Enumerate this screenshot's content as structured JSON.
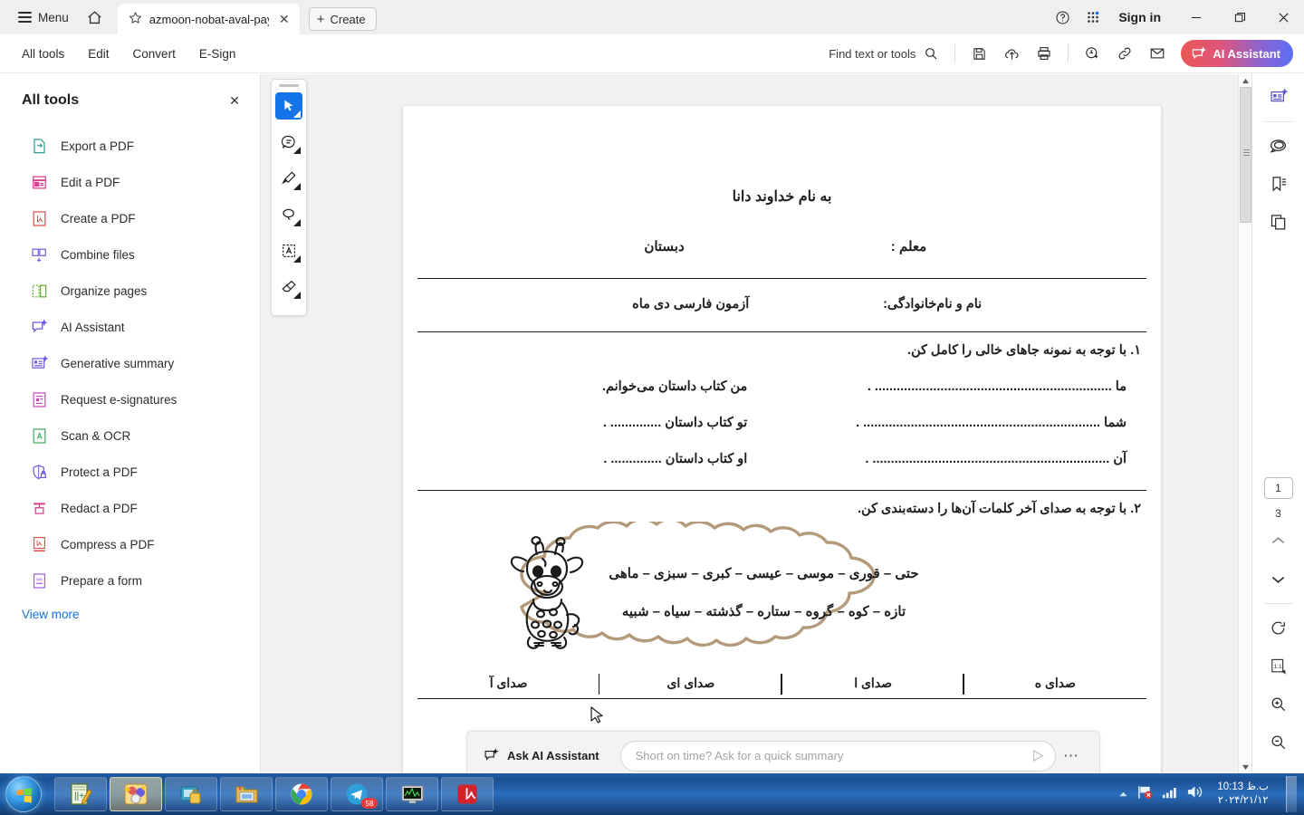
{
  "window": {
    "menu_label": "Menu",
    "signin_label": "Sign in",
    "tab_title": "azmoon-nobat-aval-pay…",
    "create_label": "Create",
    "minimize": "—",
    "maximize": "❐",
    "close": "✕"
  },
  "cmdbar": {
    "tabs": [
      "All tools",
      "Edit",
      "Convert",
      "E-Sign"
    ],
    "find_label": "Find text or tools",
    "ai_label": "AI Assistant",
    "ai_gradient_start": "#eb5757",
    "ai_gradient_end": "#5b6ef5"
  },
  "left_panel": {
    "title": "All tools",
    "close_label": "✕",
    "view_more": "View more",
    "tools": [
      {
        "label": "Export a PDF",
        "icon": "export-pdf-icon",
        "color": "#2e9e8f"
      },
      {
        "label": "Edit a PDF",
        "icon": "edit-pdf-icon",
        "color": "#d6418c"
      },
      {
        "label": "Create a PDF",
        "icon": "create-pdf-icon",
        "color": "#e05252"
      },
      {
        "label": "Combine files",
        "icon": "combine-files-icon",
        "color": "#6a5ae0"
      },
      {
        "label": "Organize pages",
        "icon": "organize-pages-icon",
        "color": "#5fa829"
      },
      {
        "label": "AI Assistant",
        "icon": "ai-assistant-icon",
        "color": "#6a5ae0"
      },
      {
        "label": "Generative summary",
        "icon": "generative-summary-icon",
        "color": "#6a5ae0"
      },
      {
        "label": "Request e-signatures",
        "icon": "request-esignatures-icon",
        "color": "#c945b8"
      },
      {
        "label": "Scan & OCR",
        "icon": "scan-ocr-icon",
        "color": "#3aa85a"
      },
      {
        "label": "Protect a PDF",
        "icon": "protect-pdf-icon",
        "color": "#6a5ae0"
      },
      {
        "label": "Redact a PDF",
        "icon": "redact-pdf-icon",
        "color": "#d6418c"
      },
      {
        "label": "Compress a PDF",
        "icon": "compress-pdf-icon",
        "color": "#e05252"
      },
      {
        "label": "Prepare a form",
        "icon": "prepare-form-icon",
        "color": "#9a5ae0"
      }
    ]
  },
  "vertical_tools": [
    {
      "name": "select-tool",
      "active": true
    },
    {
      "name": "comment-tool",
      "active": false
    },
    {
      "name": "highlight-tool",
      "active": false
    },
    {
      "name": "draw-tool",
      "active": false
    },
    {
      "name": "add-text-tool",
      "active": false
    },
    {
      "name": "erase-tool",
      "active": false
    }
  ],
  "document": {
    "bismillah": "به نام خداوند دانا",
    "school_label": "دبستان",
    "teacher_label": "معلم :",
    "exam_title": "آزمون فارسی دی ماه",
    "name_label": "نام و نام‌خانوادگی:",
    "q1_head": "۱. با توجه به نمونه جاهای خالی را کامل کن.",
    "q1_rows": [
      {
        "right": "من کتاب داستان می‌خوانم.",
        "left": "ما ................................................................. ."
      },
      {
        "right": "تو کتاب داستان .............. .",
        "left": "شما ................................................................. ."
      },
      {
        "right": "او کتاب داستان .............. .",
        "left": "آن ................................................................. ."
      }
    ],
    "q2_head": "۲. با توجه به صدای آخر کلمات آن‌ها را دسته‌بندی کن.",
    "cloud_lines": [
      "حتی  –  قوری  – موسی – عیسی – کبری – سبزی – ماهی",
      "تازه – کوه – گروه – ستاره – گذشته – سیاه – شبیه"
    ],
    "cloud_border_color": "#b39a7a",
    "table_headers": [
      "صدای آ",
      "صدای ای",
      "صدای ا",
      "صدای ه"
    ]
  },
  "right_rail": {
    "icons": [
      "generative-summary-icon",
      "comment-icon",
      "bookmark-icon",
      "pages-icon"
    ],
    "bottom_icons": [
      "rotate-icon",
      "fit-page-icon",
      "zoom-in-icon",
      "zoom-out-icon"
    ],
    "page_current": "1",
    "page_total": "3",
    "prev_label": "⌃",
    "next_label": "⌄"
  },
  "ai_bar": {
    "label": "Ask AI Assistant",
    "placeholder": "Short on time? Ask for a quick summary",
    "input_value": "",
    "send_icon": "send-icon",
    "more_label": "⋯"
  },
  "taskbar": {
    "items": [
      {
        "name": "notepad-plus-plus",
        "active": false
      },
      {
        "name": "photo-editor",
        "active": true
      },
      {
        "name": "security-app",
        "active": false
      },
      {
        "name": "file-explorer",
        "active": false
      },
      {
        "name": "google-chrome",
        "active": false
      },
      {
        "name": "telegram",
        "active": false,
        "badge": "58"
      },
      {
        "name": "system-monitor",
        "active": false
      },
      {
        "name": "adobe-acrobat",
        "active": false
      }
    ],
    "clock_time": "10:13 ب.ظ",
    "clock_date": "۲۰۲۴/۲۱/۱۲"
  }
}
